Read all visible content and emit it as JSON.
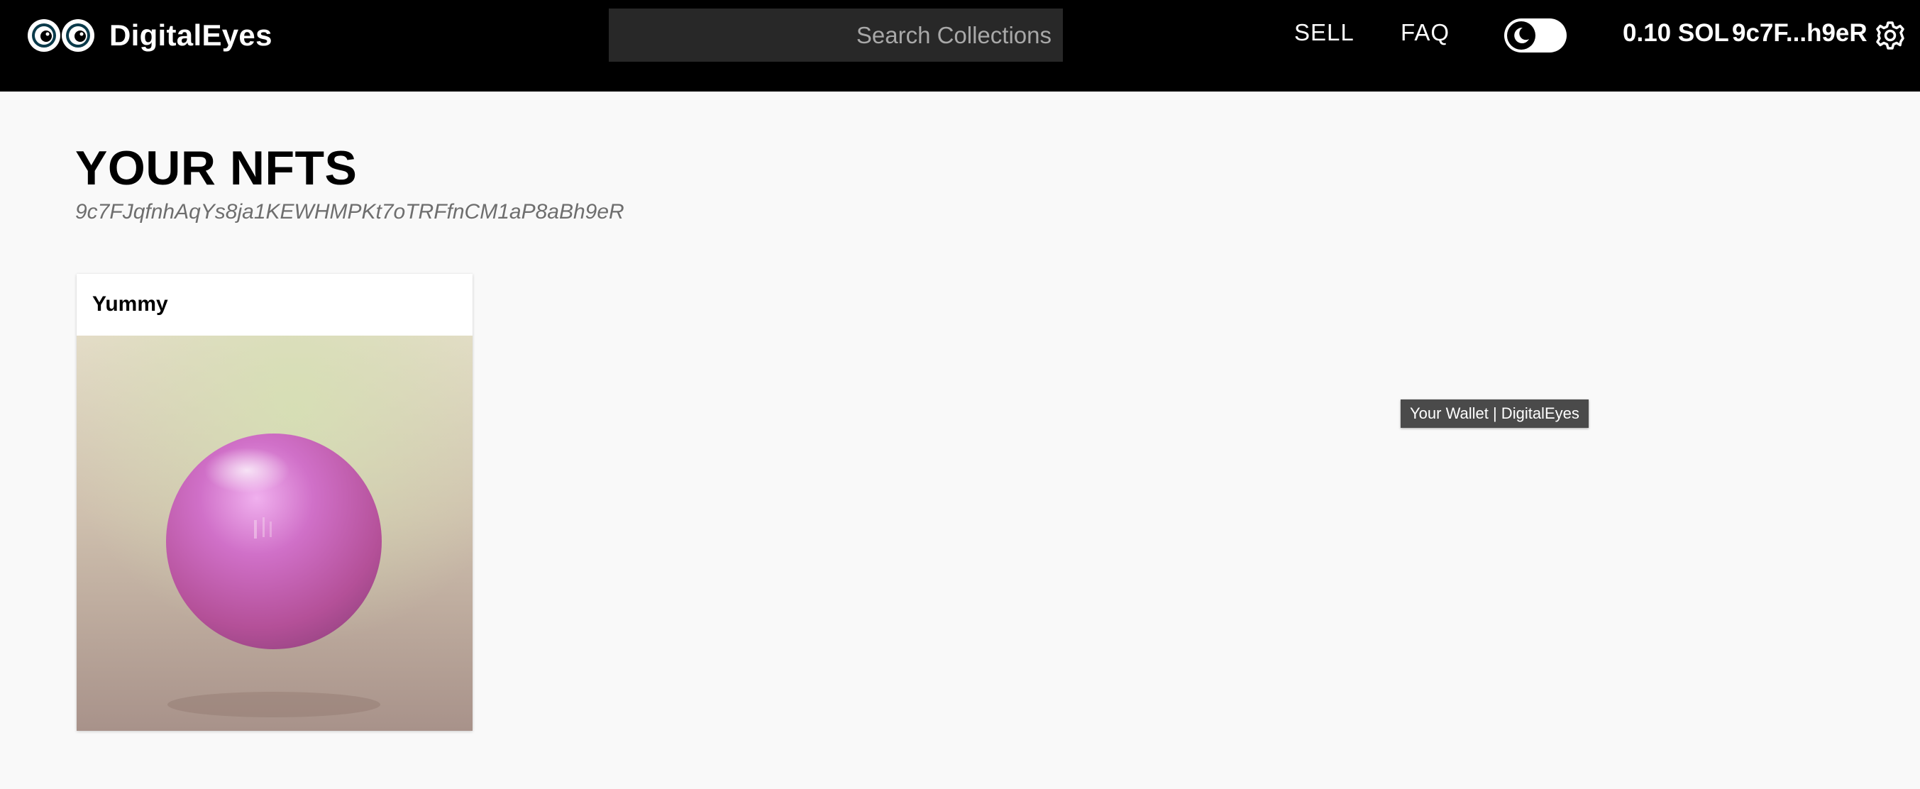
{
  "header": {
    "brand": "DigitalEyes",
    "search_placeholder": "Search Collections",
    "nav": {
      "sell": "SELL",
      "faq": "FAQ"
    },
    "theme_toggle_icon": "moon-icon",
    "balance": "0.10 SOL",
    "wallet_short": "9c7F...h9eR",
    "settings_icon": "gear-icon"
  },
  "page": {
    "title": "YOUR NFTS",
    "address": "9c7FJqfnhAqYs8ja1KEWHMPKt7oTRFfnCM1aP8aBh9eR"
  },
  "nfts": [
    {
      "name": "Yummy"
    }
  ],
  "tooltip": "Your Wallet | DigitalEyes",
  "colors": {
    "header_bg": "#000000",
    "page_bg": "#f9f9f9",
    "search_bg": "#282828",
    "nft_sphere": "#c060b8"
  }
}
